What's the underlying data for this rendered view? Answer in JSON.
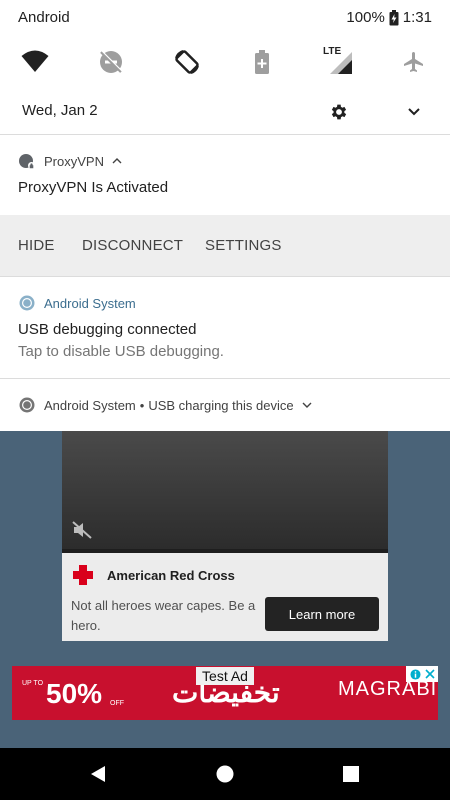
{
  "status_bar": {
    "carrier": "Android",
    "battery": "100%",
    "time": "1:31"
  },
  "quick_settings": {
    "date": "Wed, Jan 2",
    "tiles": [
      "wifi-icon",
      "do-not-disturb-icon",
      "auto-rotate-icon",
      "battery-saver-icon",
      "mobile-data-icon",
      "airplane-mode-icon"
    ],
    "signal_label": "LTE"
  },
  "notifications": {
    "vpn": {
      "app": "ProxyVPN",
      "title": "ProxyVPN Is Activated",
      "actions": [
        "HIDE",
        "DISCONNECT",
        "SETTINGS"
      ]
    },
    "usb_debug": {
      "app": "Android System",
      "title": "USB debugging connected",
      "text": "Tap to disable USB debugging."
    },
    "usb_charge": {
      "app": "Android System",
      "separator": "•",
      "text": "USB charging this device"
    }
  },
  "ad": {
    "advertiser": "American Red Cross",
    "body": "Not all heroes wear capes. Be a hero.",
    "cta": "Learn more",
    "banner_label": "Test Ad",
    "banner_discount_prefix": "UP TO",
    "banner_discount": "50%",
    "banner_discount_suffix": "OFF",
    "banner_arabic": "تخفيضات",
    "banner_brand": "MAGRABI"
  },
  "colors": {
    "accent": "#4a6378",
    "banner": "#c8102e",
    "link_blue": "#3c6e8f"
  }
}
